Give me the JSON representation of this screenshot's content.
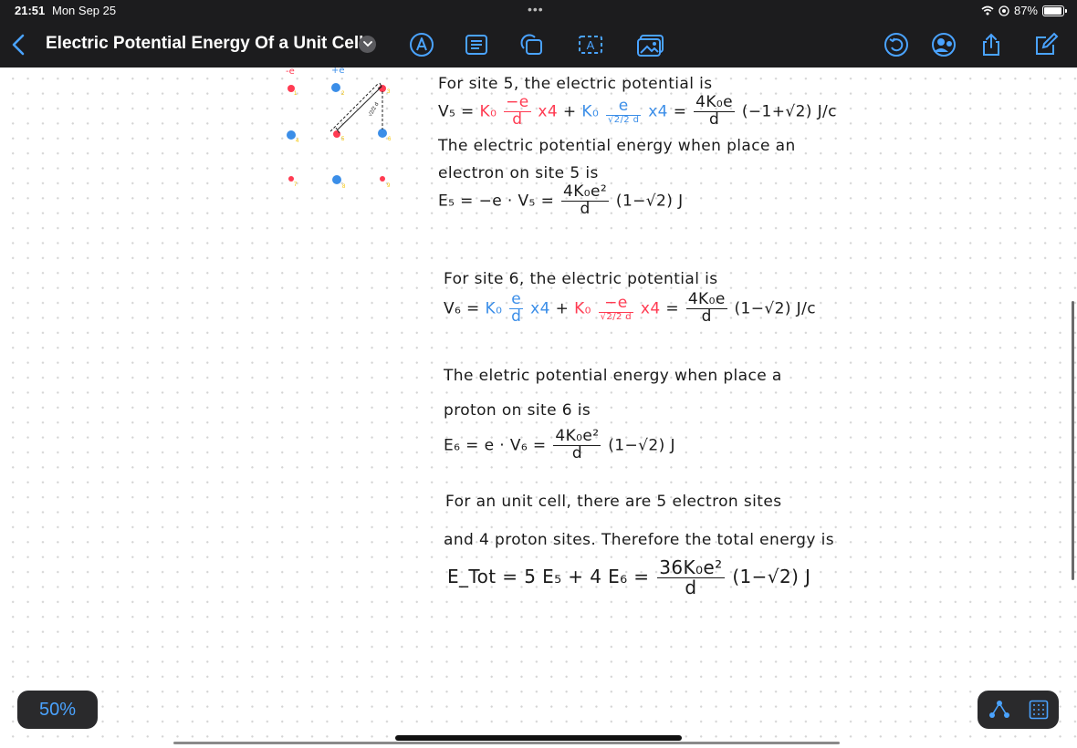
{
  "status_bar": {
    "time": "21:51",
    "date": "Mon Sep 25",
    "dots": "•••",
    "battery": "87%",
    "battery_fraction": 0.87
  },
  "nav": {
    "title": "Electric Potential Energy Of a Unit Cell"
  },
  "zoom": {
    "label": "50%"
  },
  "colors": {
    "bar_bg": "#1c1c1e",
    "accent": "#4aa3ff",
    "electron_red": "#ff3b52",
    "proton_blue": "#3b8ee8",
    "site_yellow": "#f5c400"
  },
  "diagram": {
    "charge_electron": "-e",
    "charge_proton": "+e",
    "length_label": "√2/2 d"
  },
  "notes": {
    "s5_line1": "For site 5, the electric potential is",
    "s5_v_lhs": "V₅ =",
    "k0": "K₀",
    "minus_e": "−e",
    "e": "e",
    "d": "d",
    "rt2_2_d": "√2/2 d",
    "x4": "x4",
    "plus": "+",
    "eq": "=",
    "s5_v_num": "4K₀e",
    "s5_v_tail": "(−1+√2) J/c",
    "s5_line2": "The electric potential energy when place an",
    "s5_line3": "electron on site 5 is",
    "s5_e_lhs": "E₅ = −e · V₅ =",
    "s5_e_num": "4K₀e²",
    "s5_e_tail": "(1−√2) J",
    "s6_line1": "For site 6, the electric potential is",
    "s6_v_lhs": "V₆ =",
    "s6_v_num": "4K₀e",
    "s6_v_tail": "(1−√2) J/c",
    "s6_line2": "The eletric potential energy when place a",
    "s6_line3": "proton on site 6 is",
    "s6_e_lhs": "E₆ = e · V₆ =",
    "s6_e_num": "4K₀e²",
    "s6_e_tail": "(1−√2) J",
    "t_line1": "For an unit cell, there are  5 electron sites",
    "t_line2": "and 4 proton sites. Therefore the total energy is",
    "t_lhs": "E_Tot = 5 E₅ + 4 E₆ =",
    "t_num": "36K₀e²",
    "t_tail": "(1−√2)  J"
  }
}
